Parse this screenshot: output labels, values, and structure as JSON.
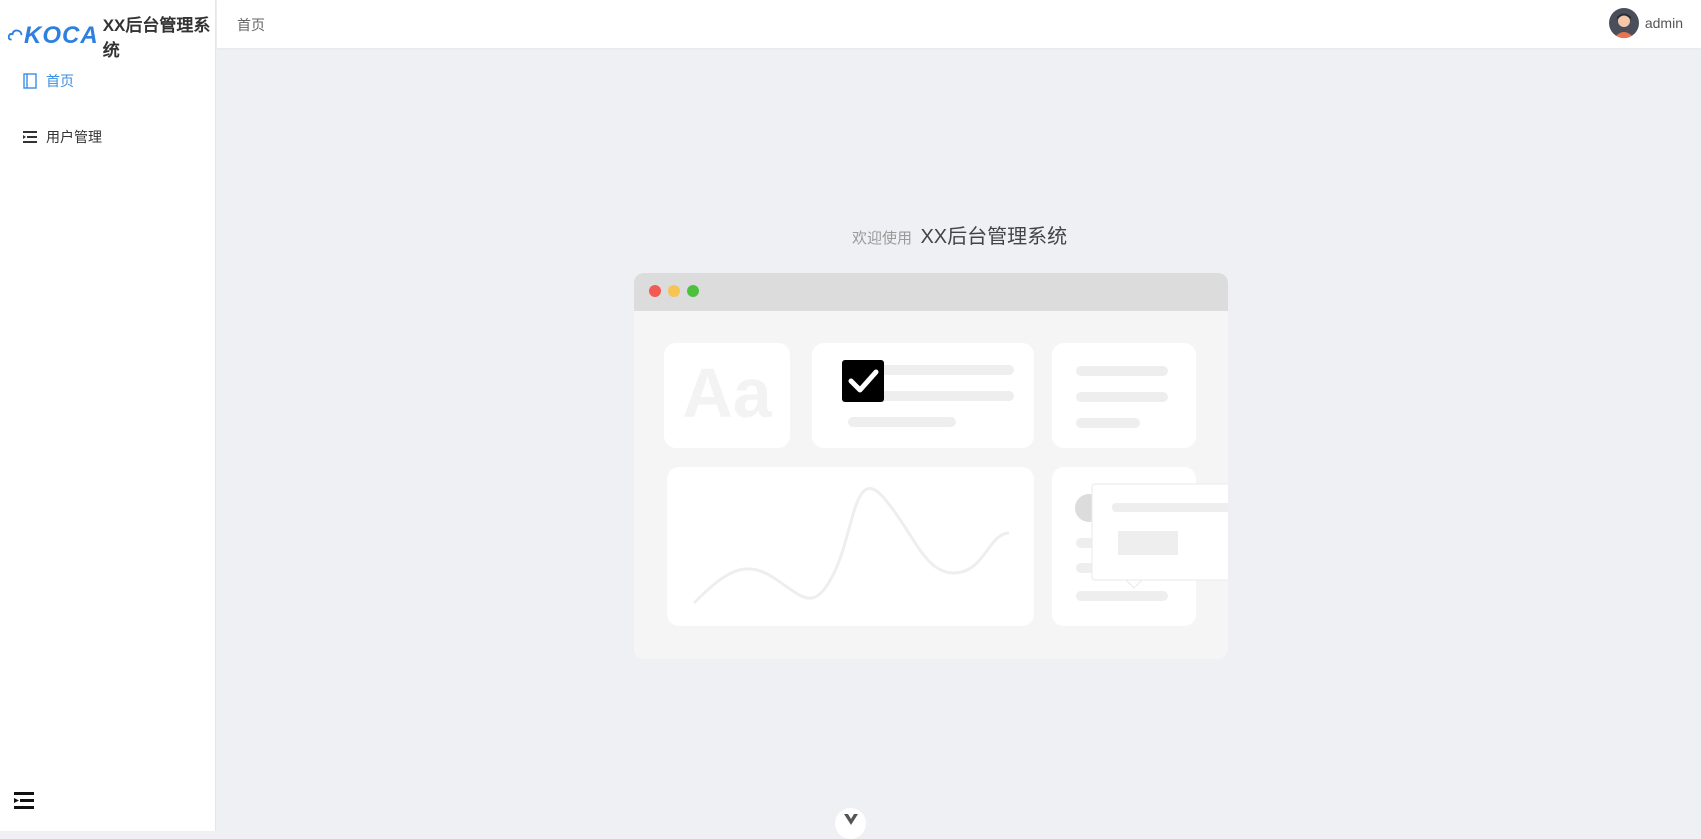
{
  "sidebar": {
    "logo_mark": "KOCA",
    "logo_title": "XX后台管理系统",
    "items": [
      {
        "label": "首页",
        "icon": "notebook-icon",
        "active": true
      },
      {
        "label": "用户管理",
        "icon": "list-indent-icon",
        "active": false
      }
    ],
    "collapse_icon": "fold-menu-icon"
  },
  "header": {
    "breadcrumb": "首页",
    "user": {
      "name": "admin",
      "avatar": "avatar-icon"
    }
  },
  "main": {
    "welcome_prefix": "欢迎使用",
    "welcome_title": "XX后台管理系统",
    "illustration": {
      "window_buttons": [
        "#f25a54",
        "#f7c453",
        "#4dc13f"
      ],
      "card_text": "Aa"
    }
  },
  "colors": {
    "accent": "#3a8ee6",
    "background": "#eff0f4",
    "sidebar_bg": "#ffffff"
  }
}
